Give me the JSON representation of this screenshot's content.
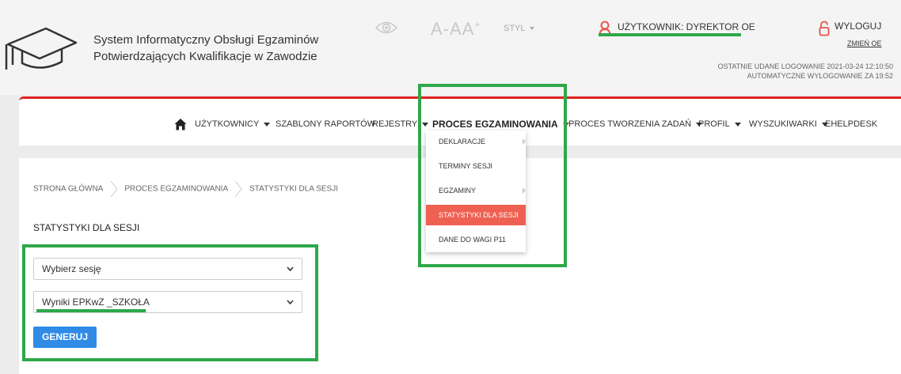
{
  "header": {
    "system_title_line1": "System Informatyczny Obsługi Egzaminów",
    "system_title_line2": "Potwierdzających Kwalifikacje w Zawodzie",
    "font_size_label": "A-AA",
    "font_size_plus": "+",
    "style_label": "STYL",
    "user_label": "UŻYTKOWNIK: DYREKTOR OE",
    "logout_label": "WYLOGUJ",
    "change_label": "ZMIEŃ OE",
    "last_login": "OSTATNIE UDANE LOGOWANIE 2021-03-24 12:10:50",
    "auto_logout": "AUTOMATYCZNE WYLOGOWANIE ZA  19:52"
  },
  "nav": {
    "items": [
      {
        "label": "UŻYTKOWNICY",
        "dropdown": true
      },
      {
        "label": "SZABLONY RAPORTÓW",
        "dropdown": false
      },
      {
        "label": "REJESTRY",
        "dropdown": true
      },
      {
        "label": "PROCES EGZAMINOWANIA",
        "dropdown": true,
        "active": true
      },
      {
        "label": "PROCES TWORZENIA ZADAŃ",
        "dropdown": true
      },
      {
        "label": "PROFIL",
        "dropdown": true
      },
      {
        "label": "WYSZUKIWARKI",
        "dropdown": true
      },
      {
        "label": "EHELPDESK",
        "dropdown": false
      }
    ]
  },
  "dropdown": {
    "items": [
      {
        "label": "DEKLARACJE",
        "submenu": true
      },
      {
        "label": "TERMINY SESJI",
        "submenu": false
      },
      {
        "label": "EGZAMINY",
        "submenu": true
      },
      {
        "label": "STATYSTYKI DLA SESJI",
        "submenu": false,
        "active": true
      },
      {
        "label": "DANE DO WAGI P11",
        "submenu": false
      }
    ]
  },
  "breadcrumb": [
    "STRONA GŁÓWNA",
    "PROCES EGZAMINOWANIA",
    "STATYSTYKI DLA SESJI"
  ],
  "main": {
    "title": "STATYSTYKI DLA SESJI",
    "session_select": "Wybierz sesję",
    "report_select": "Wyniki EPKwZ _SZKOŁA",
    "generate_button": "GENERUJ"
  },
  "colors": {
    "accent_red": "#e02020",
    "active_menu": "#ee6052",
    "button_blue": "#2f8be6",
    "highlight_green": "#2ea84a",
    "user_icon": "#e8534a"
  }
}
